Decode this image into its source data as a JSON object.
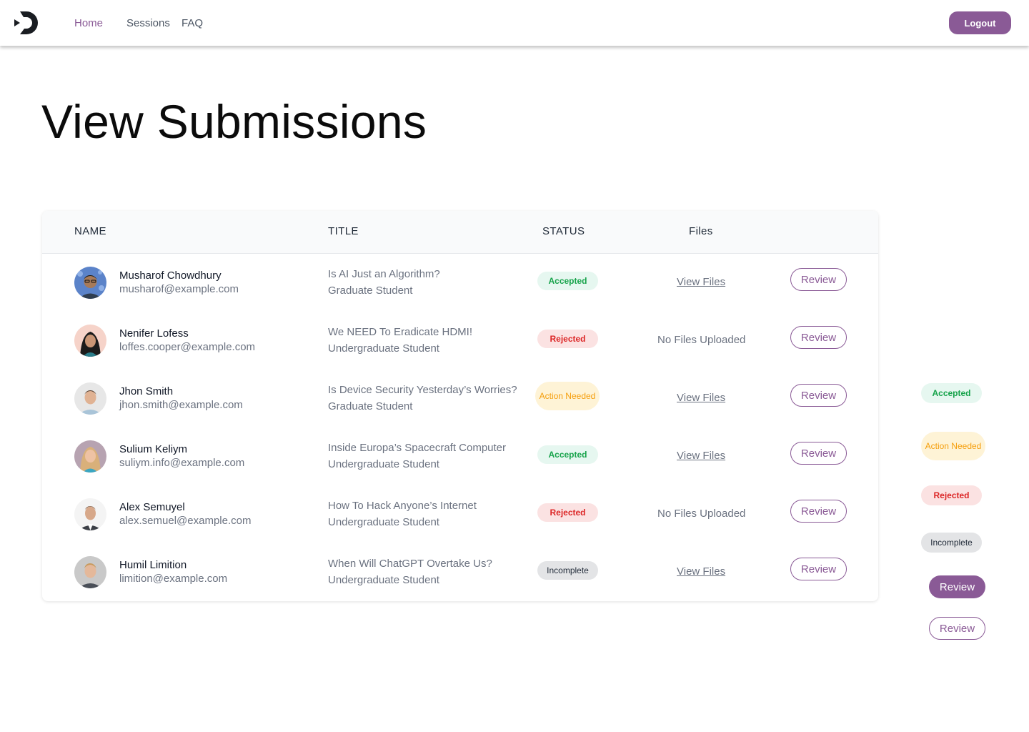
{
  "nav": {
    "home": "Home",
    "sessions": "Sessions",
    "faq": "FAQ",
    "logout": "Logout"
  },
  "page": {
    "title": "View Submissions"
  },
  "table": {
    "headers": {
      "name": "NAME",
      "title": "TITLE",
      "status": "STATUS",
      "files": "Files"
    },
    "rows": [
      {
        "name": "Musharof Chowdhury",
        "email": "musharof@example.com",
        "title": "Is AI Just an Algorithm?",
        "role": "Graduate Student",
        "status": "Accepted",
        "files": "View Files",
        "review": "Review"
      },
      {
        "name": "Nenifer Lofess",
        "email": "loffes.cooper@example.com",
        "title": "We NEED To Eradicate HDMI!",
        "role": "Undergraduate Student",
        "status": "Rejected",
        "files": "No Files Uploaded",
        "review": "Review"
      },
      {
        "name": "Jhon Smith",
        "email": "jhon.smith@example.com",
        "title": "Is Device Security Yesterday’s Worries?",
        "role": "Graduate Student",
        "status": "Action Needed",
        "files": "View Files",
        "review": "Review"
      },
      {
        "name": "Sulium Keliym",
        "email": "suliym.info@example.com",
        "title": "Inside Europa’s Spacecraft Computer",
        "role": "Undergraduate Student",
        "status": "Accepted",
        "files": "View Files",
        "review": "Review"
      },
      {
        "name": "Alex Semuyel",
        "email": "alex.semuel@example.com",
        "title": "How To Hack Anyone’s Internet",
        "role": "Undergraduate Student",
        "status": "Rejected",
        "files": "No Files Uploaded",
        "review": "Review"
      },
      {
        "name": "Humil Limition",
        "email": "limition@example.com",
        "title": "When Will ChatGPT Overtake Us?",
        "role": "Undergraduate Student",
        "status": "Incomplete",
        "files": "View Files",
        "review": "Review"
      }
    ]
  },
  "legend": {
    "accepted": "Accepted",
    "action_needed": "Action Needed",
    "rejected": "Rejected",
    "incomplete": "Incomplete",
    "review_filled": "Review",
    "review_outline": "Review"
  },
  "colors": {
    "accent": "#8a5a96",
    "accepted_bg": "#e6f7f0",
    "accepted_fg": "#16a34a",
    "rejected_bg": "#fbe2e2",
    "rejected_fg": "#dc2626",
    "action_bg": "#fef3d6",
    "action_fg": "#f59e0b",
    "incomplete_bg": "#e3e4e6",
    "incomplete_fg": "#1f2937"
  }
}
